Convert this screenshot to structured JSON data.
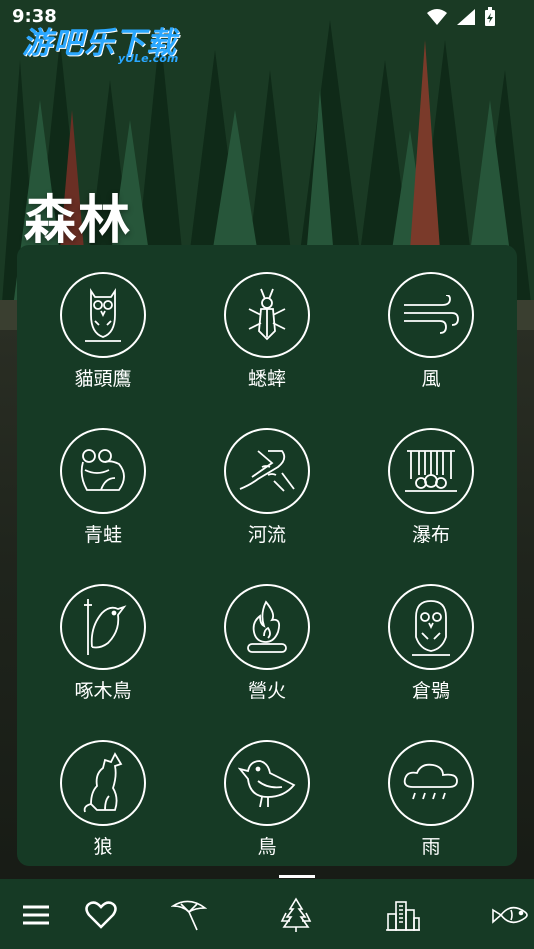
{
  "status_bar": {
    "time": "9:38"
  },
  "watermark": {
    "text": "游吧乐下载",
    "sub": "yULe.com"
  },
  "page": {
    "title": "森林"
  },
  "sounds": [
    {
      "label": "貓頭鷹",
      "icon": "owl-icon"
    },
    {
      "label": "蟋蟀",
      "icon": "cricket-icon"
    },
    {
      "label": "風",
      "icon": "wind-icon"
    },
    {
      "label": "青蛙",
      "icon": "frog-icon"
    },
    {
      "label": "河流",
      "icon": "river-icon"
    },
    {
      "label": "瀑布",
      "icon": "waterfall-icon"
    },
    {
      "label": "啄木鳥",
      "icon": "woodpecker-icon"
    },
    {
      "label": "營火",
      "icon": "campfire-icon"
    },
    {
      "label": "倉鴞",
      "icon": "barn-owl-icon"
    },
    {
      "label": "狼",
      "icon": "wolf-icon"
    },
    {
      "label": "鳥",
      "icon": "bird-icon"
    },
    {
      "label": "雨",
      "icon": "rain-icon"
    }
  ],
  "bottom_nav": [
    {
      "icon": "menu-icon"
    },
    {
      "icon": "heart-icon"
    },
    {
      "icon": "beach-umbrella-icon"
    },
    {
      "icon": "forest-icon",
      "active": true
    },
    {
      "icon": "city-icon"
    },
    {
      "icon": "fish-icon"
    }
  ],
  "colors": {
    "panel": "#163a25",
    "icon_stroke": "#ffffff",
    "text": "#ffffff"
  }
}
